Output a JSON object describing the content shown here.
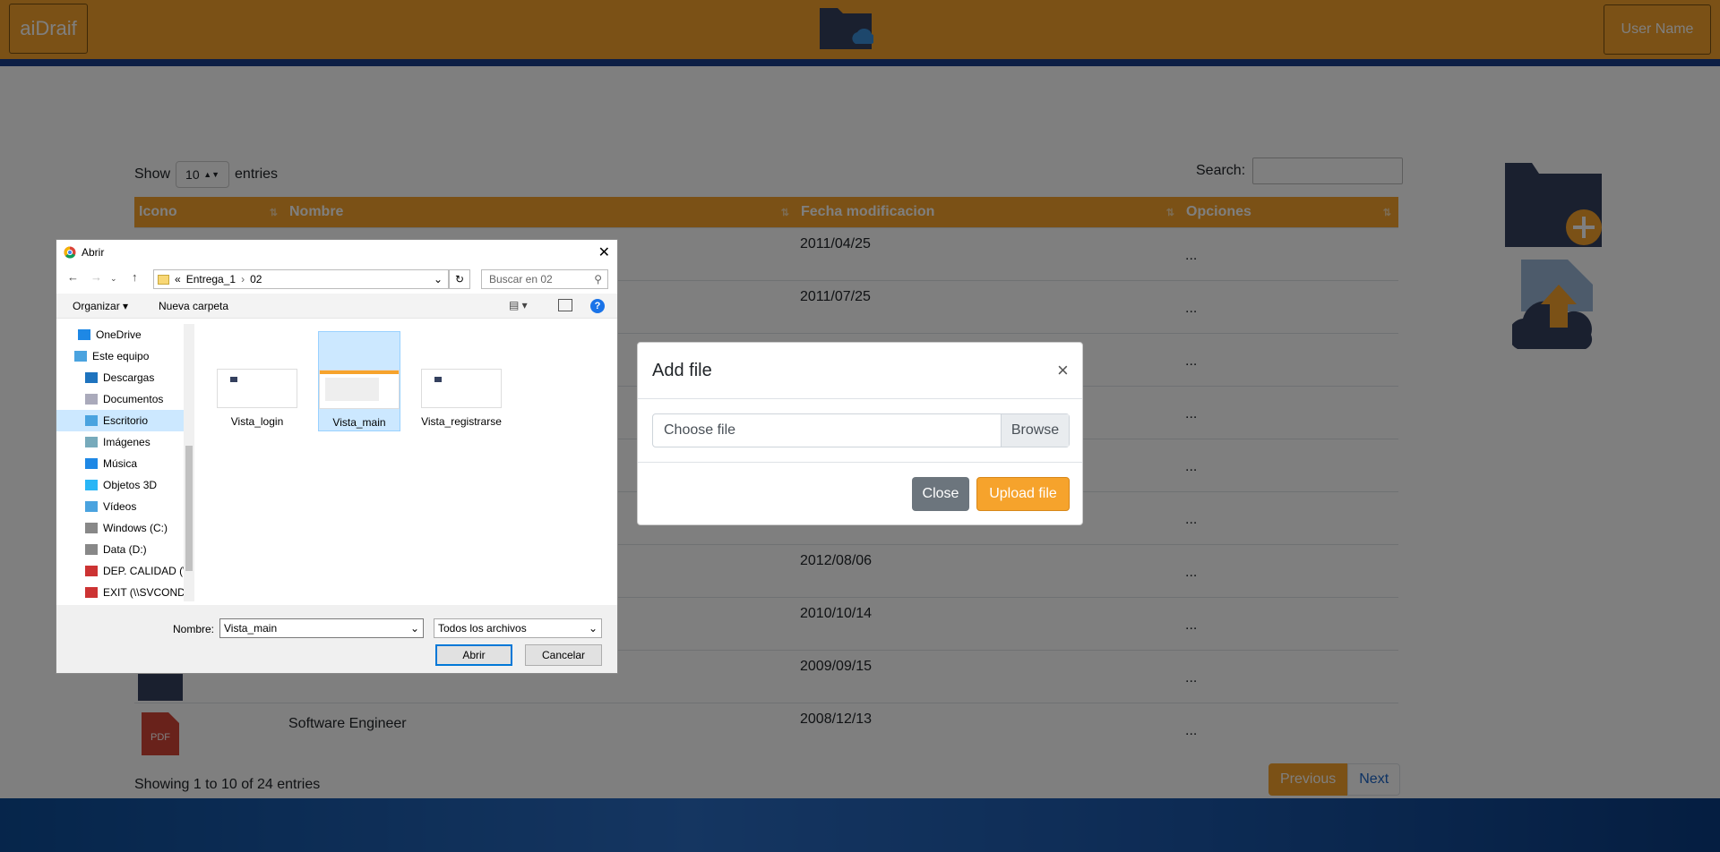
{
  "header": {
    "brand": "aiDraif",
    "user": "User Name"
  },
  "table_controls": {
    "show_label": "Show",
    "entries_value": "10",
    "entries_label": "entries",
    "search_label": "Search:",
    "search_value": ""
  },
  "table": {
    "columns": [
      "Icono",
      "Nombre",
      "Fecha modificacion",
      "Opciones"
    ],
    "rows": [
      {
        "nombre": "",
        "fecha": "2011/04/25",
        "opciones": "..."
      },
      {
        "nombre": "",
        "fecha": "2011/07/25",
        "opciones": "..."
      },
      {
        "nombre": "",
        "fecha": "",
        "opciones": "..."
      },
      {
        "nombre": "",
        "fecha": "",
        "opciones": "..."
      },
      {
        "nombre": "",
        "fecha": "",
        "opciones": "..."
      },
      {
        "nombre": "",
        "fecha": "",
        "opciones": "..."
      },
      {
        "nombre": "",
        "fecha": "2012/08/06",
        "opciones": "..."
      },
      {
        "nombre": "",
        "fecha": "2010/10/14",
        "opciones": "..."
      },
      {
        "nombre": "",
        "fecha": "2009/09/15",
        "opciones": "..."
      },
      {
        "nombre": "Software Engineer",
        "fecha": "2008/12/13",
        "opciones": "...",
        "icon_label": "PDF"
      }
    ],
    "info": "Showing 1 to 10 of 24 entries",
    "prev": "Previous",
    "next": "Next"
  },
  "modal": {
    "title": "Add file",
    "close_x": "×",
    "file_placeholder": "Choose file",
    "browse": "Browse",
    "close_button": "Close",
    "upload_button": "Upload file"
  },
  "dialog": {
    "title": "Abrir",
    "path": [
      "«",
      "Entrega_1",
      "›",
      "02"
    ],
    "search_placeholder": "Buscar en 02",
    "organize": "Organizar ▾",
    "new_folder": "Nueva carpeta",
    "tree": [
      "OneDrive",
      "Este equipo",
      "Descargas",
      "Documentos",
      "Escritorio",
      "Imágenes",
      "Música",
      "Objetos 3D",
      "Vídeos",
      "Windows (C:)",
      "Data (D:)",
      "DEP. CALIDAD (\\",
      "EXIT (\\\\SVCOND"
    ],
    "files": [
      "Vista_login",
      "Vista_main",
      "Vista_registrarse"
    ],
    "name_label": "Nombre:",
    "name_value": "Vista_main",
    "type_value": "Todos los archivos",
    "open": "Abrir",
    "cancel": "Cancelar"
  },
  "colors": {
    "accent": "#f6a32c",
    "navy": "#34405e",
    "blue": "#1b3f8a"
  }
}
